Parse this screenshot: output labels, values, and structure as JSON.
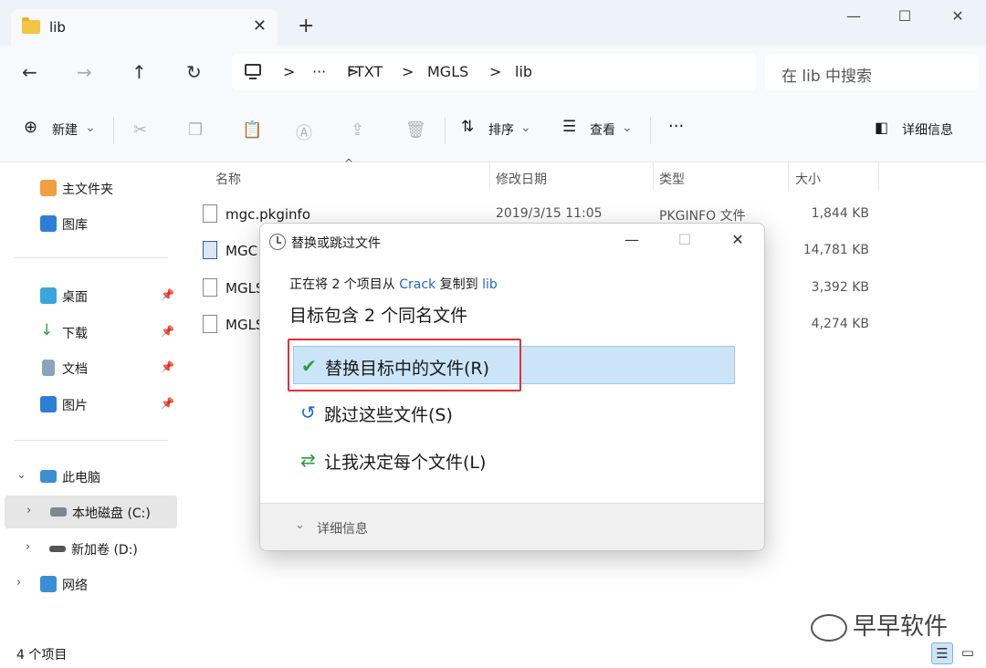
{
  "window": {
    "tab_label": "lib",
    "tab_close": "✕",
    "new_tab": "+",
    "minimize": "—",
    "maximize": "☐",
    "close": "✕"
  },
  "nav": {
    "back": "←",
    "forward": "→",
    "up": "↑",
    "refresh": "↻",
    "more_crumbs": "···",
    "sep": ">",
    "breadcrumbs": [
      "FTXT",
      "MGLS",
      "lib"
    ],
    "search_placeholder": "在 lib 中搜索"
  },
  "toolbar": {
    "new_label": "新建",
    "sort_label": "排序",
    "view_label": "查看",
    "more": "···",
    "details_label": "详细信息",
    "dropdown": "⌄"
  },
  "sidebar": {
    "items": [
      {
        "label": "主文件夹",
        "icon": "home-icon"
      },
      {
        "label": "图库",
        "icon": "gallery-icon"
      },
      {
        "label": "桌面",
        "icon": "desktop-icon"
      },
      {
        "label": "下载",
        "icon": "download-icon"
      },
      {
        "label": "文档",
        "icon": "document-icon"
      },
      {
        "label": "图片",
        "icon": "picture-icon"
      },
      {
        "label": "此电脑",
        "icon": "computer-icon"
      },
      {
        "label": "本地磁盘 (C:)",
        "icon": "drive-icon"
      },
      {
        "label": "新加卷 (D:)",
        "icon": "drive-icon"
      },
      {
        "label": "网络",
        "icon": "network-icon"
      }
    ],
    "pin": "📌",
    "chev_right": "›",
    "chev_down": "⌄"
  },
  "columns": {
    "name": "名称",
    "modified": "修改日期",
    "type": "类型",
    "size": "大小",
    "sort_indicator": "^"
  },
  "files": [
    {
      "name": "mgc.pkginfo",
      "date": "2019/3/15 11:05",
      "type": "PKGINFO 文件",
      "size": "1,844 KB"
    },
    {
      "name": "MGC",
      "date": "",
      "type": "",
      "size": "14,781 KB"
    },
    {
      "name": "MGLS",
      "date": "",
      "type": "",
      "size": "3,392 KB"
    },
    {
      "name": "MGLS",
      "date": "",
      "type": "",
      "size": "4,274 KB"
    }
  ],
  "status": {
    "item_count": "4 个项目"
  },
  "watermark": {
    "text": "早早软件"
  },
  "dialog": {
    "title": "替换或跳过文件",
    "minimize": "—",
    "maximize": "☐",
    "close": "✕",
    "line1_prefix": "正在将 2 个项目从 ",
    "line1_source": "Crack",
    "line1_mid": " 复制到 ",
    "line1_dest": "lib",
    "line2": "目标包含 2 个同名文件",
    "options": [
      {
        "label": "替换目标中的文件(R)",
        "icon": "✔"
      },
      {
        "label": "跳过这些文件(S)",
        "icon": "↺"
      },
      {
        "label": "让我决定每个文件(L)",
        "icon": "⇄"
      }
    ],
    "more_details": "详细信息",
    "more_chev": "⌄"
  },
  "colors": {
    "accent": "#0067c0",
    "highlight": "#cce4f7",
    "annotation_red": "#e0303a",
    "check_green": "#2e9e3e"
  }
}
